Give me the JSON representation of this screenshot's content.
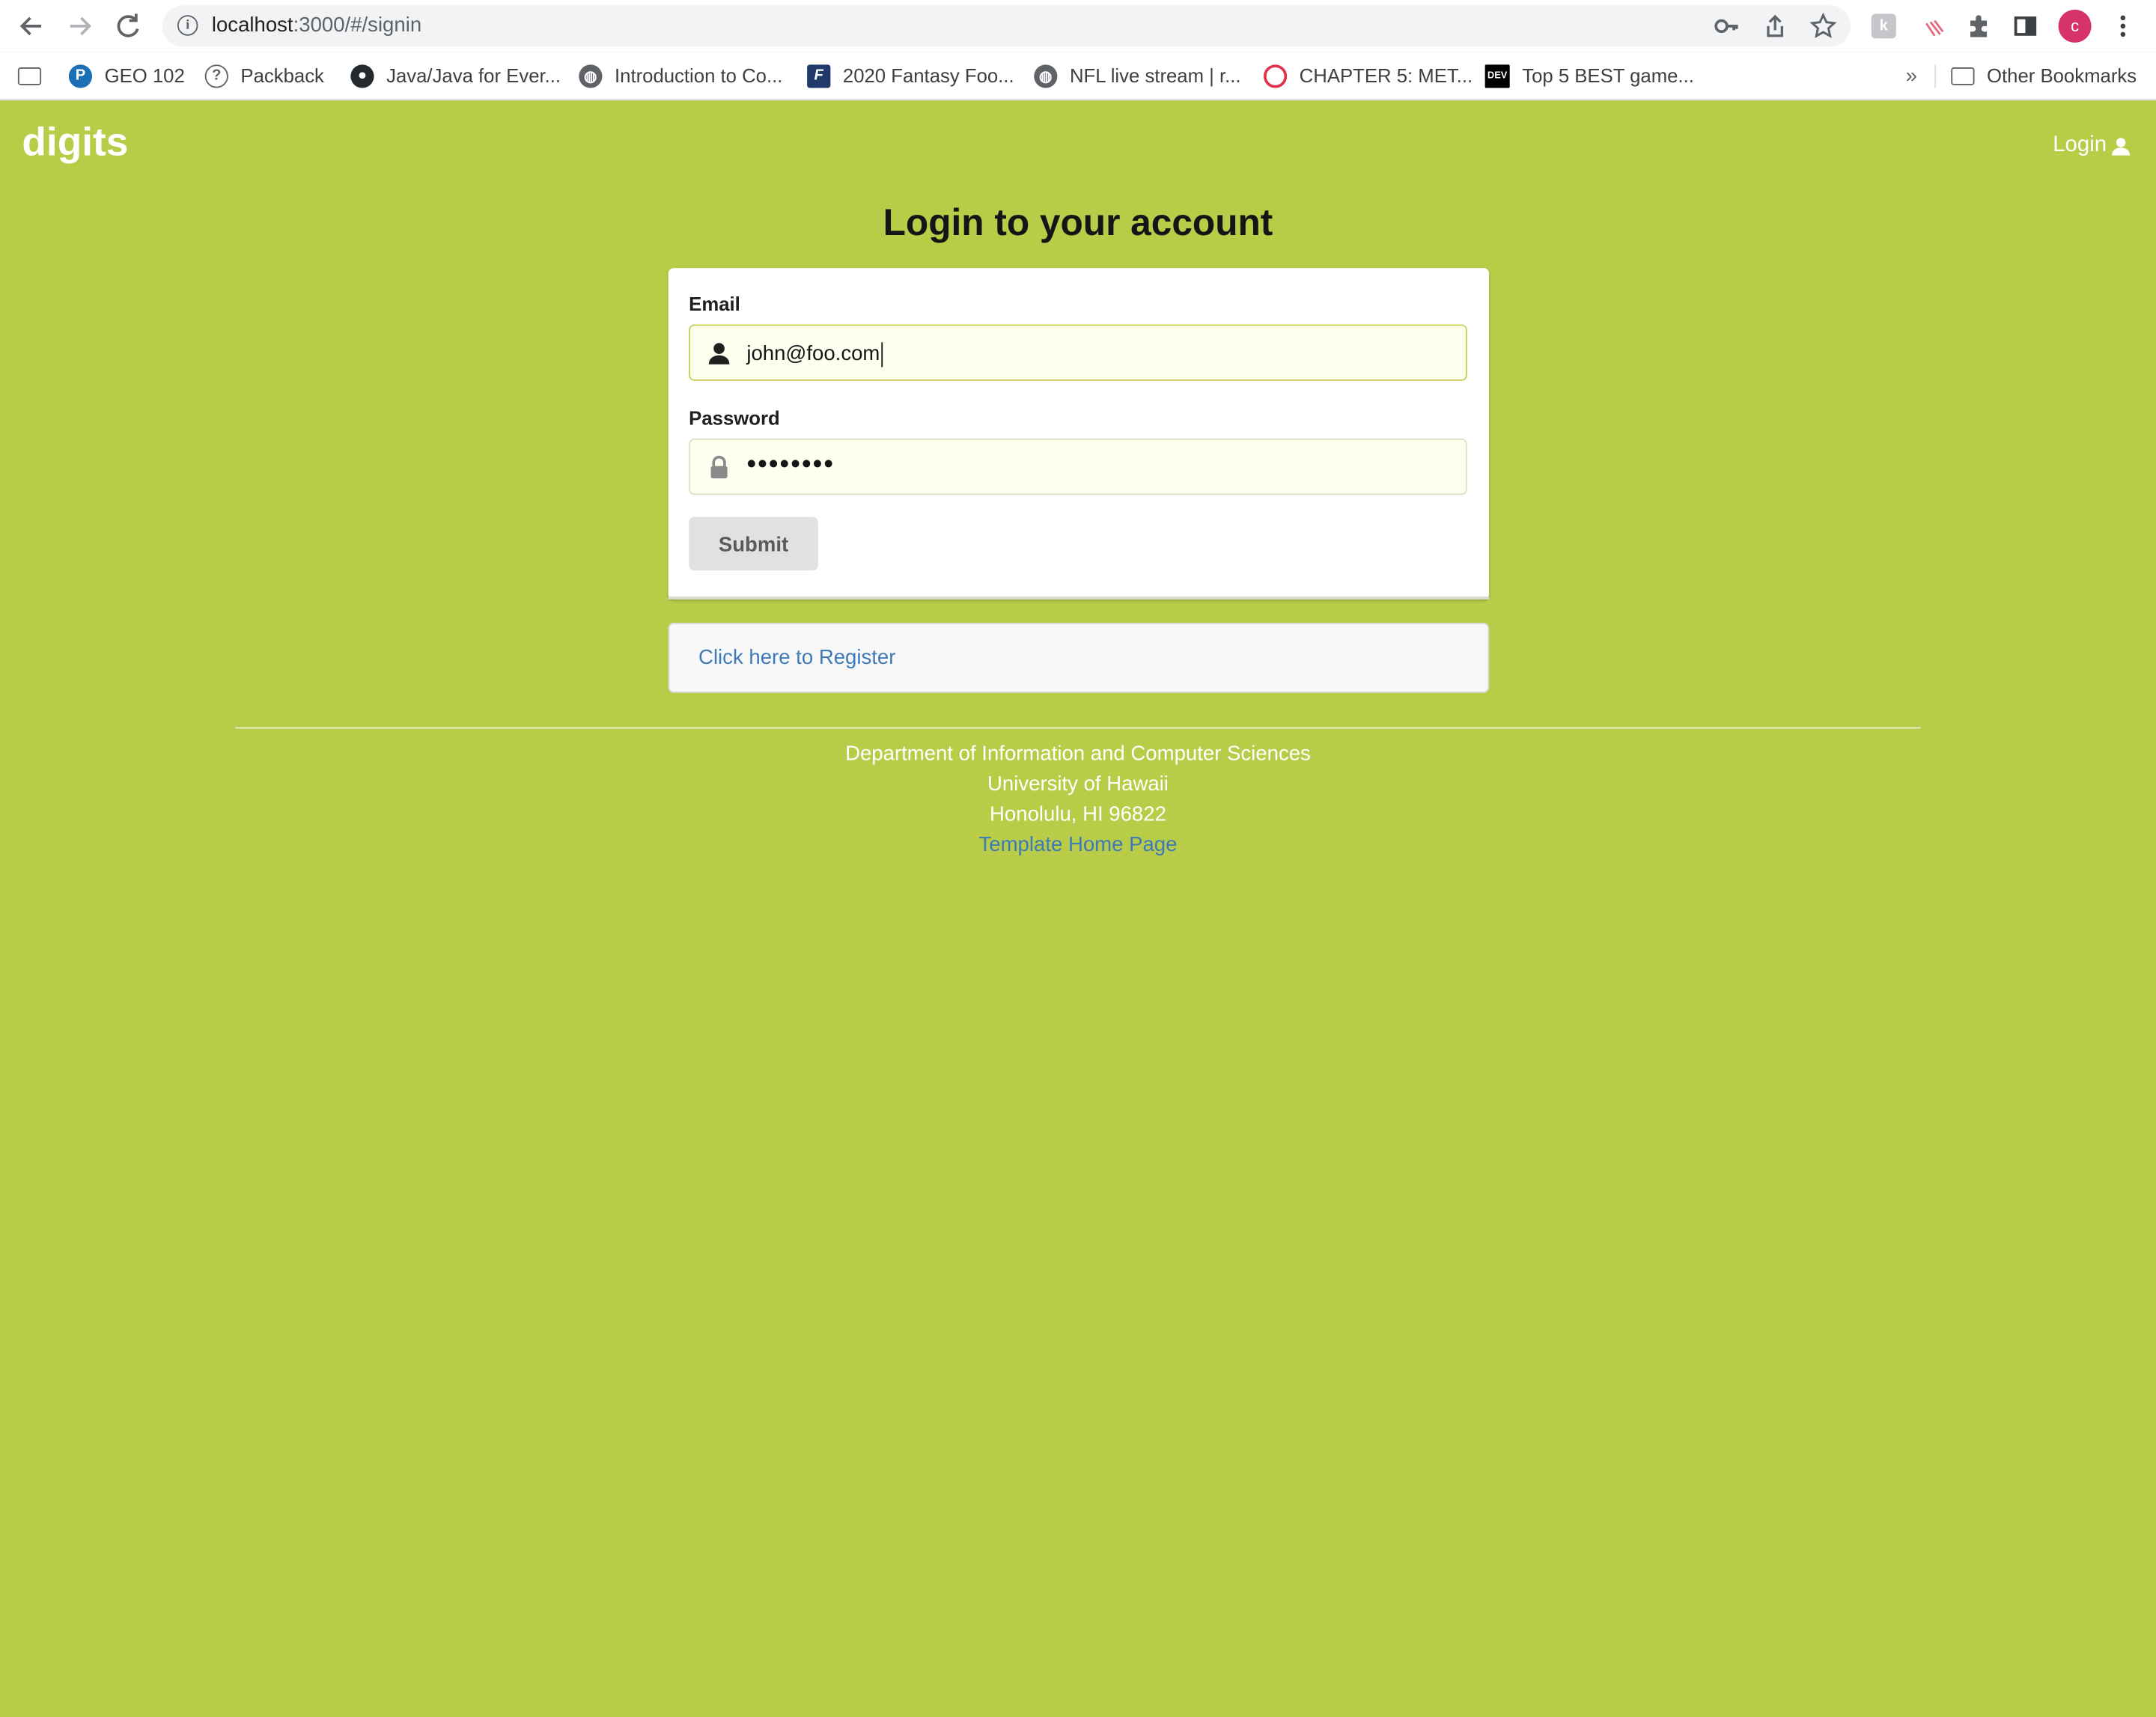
{
  "browser": {
    "url_host": "localhost",
    "url_rest": ":3000/#/signin",
    "bookmarks": [
      {
        "label": "GEO 102",
        "icon": "pearson-icon",
        "color": "#1a6fb5",
        "glyph": "P"
      },
      {
        "label": "Packback",
        "icon": "packback-icon",
        "color": "#5f6368",
        "glyph": "?"
      },
      {
        "label": "Java/Java for Ever...",
        "icon": "github-icon",
        "color": "#24292e",
        "glyph": "●"
      },
      {
        "label": "Introduction to Co...",
        "icon": "globe-icon",
        "color": "#5f6368",
        "glyph": "◍"
      },
      {
        "label": "2020 Fantasy Foo...",
        "icon": "fantasy-icon",
        "color": "#1f3a6b",
        "glyph": "F"
      },
      {
        "label": "NFL live stream | r...",
        "icon": "globe-icon",
        "color": "#5f6368",
        "glyph": "◍"
      },
      {
        "label": "CHAPTER 5: MET...",
        "icon": "o-icon",
        "color": "#e0334b",
        "glyph": "O"
      },
      {
        "label": "Top 5 BEST game...",
        "icon": "dev-icon",
        "color": "#000000",
        "glyph": "DEV"
      }
    ],
    "more_label": "»",
    "other_bookmarks": "Other Bookmarks",
    "avatar_letter": "c"
  },
  "navbar": {
    "brand": "digits",
    "login": "Login"
  },
  "signin": {
    "heading": "Login to your account",
    "email_label": "Email",
    "email_value": "john@foo.com",
    "password_label": "Password",
    "password_value": "••••••••",
    "submit": "Submit",
    "register_link": "Click here to Register"
  },
  "footer": {
    "line1": "Department of Information and Computer Sciences",
    "line2": "University of Hawaii",
    "line3": "Honolulu, HI 96822",
    "link": "Template Home Page"
  },
  "colors": {
    "background": "#b9cc48",
    "link": "#3e7ab8"
  }
}
